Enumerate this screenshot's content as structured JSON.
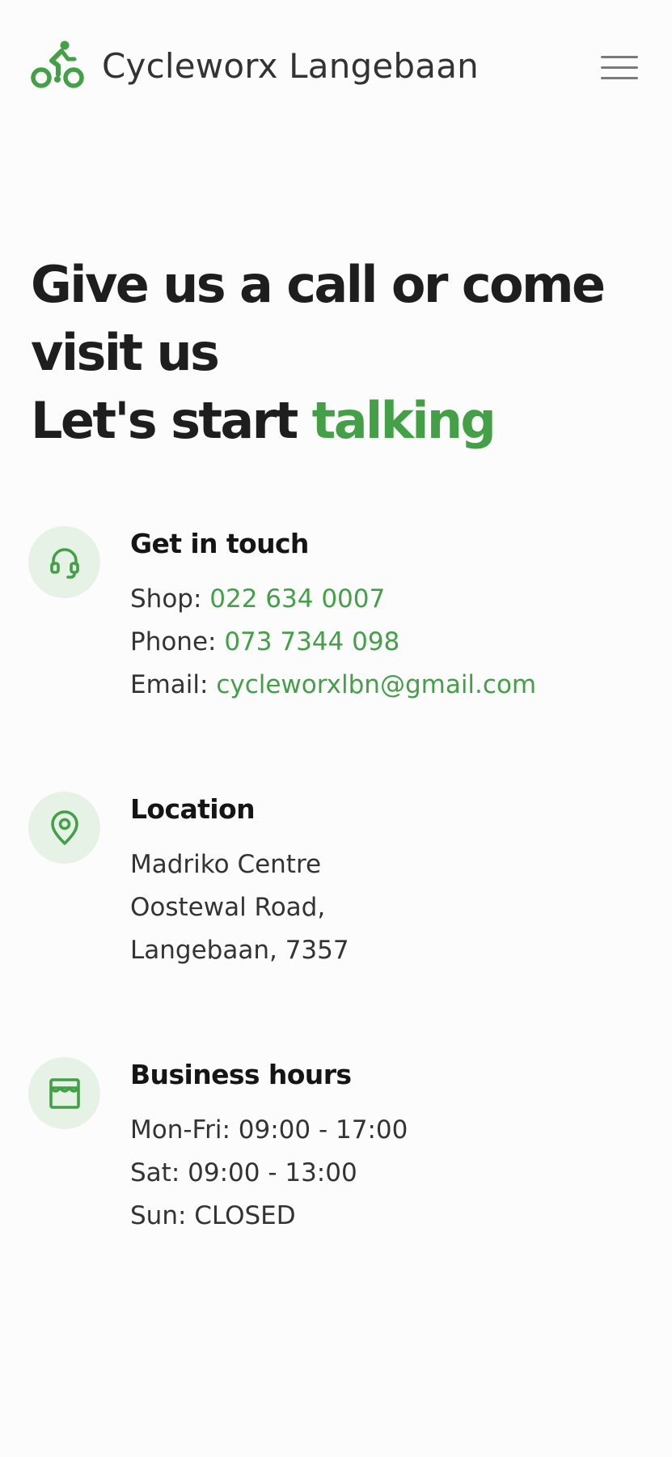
{
  "brand": {
    "name": "Cycleworx Langebaan",
    "logo_icon": "cyclist-icon",
    "accent_color": "#43a047"
  },
  "nav": {
    "menu_icon": "hamburger-menu-icon"
  },
  "hero": {
    "line1": "Give us a call or come visit us",
    "line2_prefix": "Let's start ",
    "line2_highlight": "talking"
  },
  "contact": {
    "icon": "headset-icon",
    "title": "Get in touch",
    "shop_label": "Shop: ",
    "shop_value": "022 634 0007",
    "phone_label": "Phone: ",
    "phone_value": "073 7344 098",
    "email_label": "Email: ",
    "email_value": "cycleworxlbn@gmail.com"
  },
  "location": {
    "icon": "map-pin-icon",
    "title": "Location",
    "lines": [
      "Madriko Centre",
      "Oostewal Road,",
      "Langebaan, 7357"
    ]
  },
  "hours": {
    "icon": "storefront-icon",
    "title": "Business hours",
    "lines": [
      "Mon-Fri: 09:00 - 17:00",
      "Sat: 09:00 - 13:00",
      "Sun: CLOSED"
    ]
  },
  "colors": {
    "accent": "#43a047",
    "icon_bg": "#e6f2e6",
    "heading": "#1e1e1e",
    "text": "#333333"
  }
}
